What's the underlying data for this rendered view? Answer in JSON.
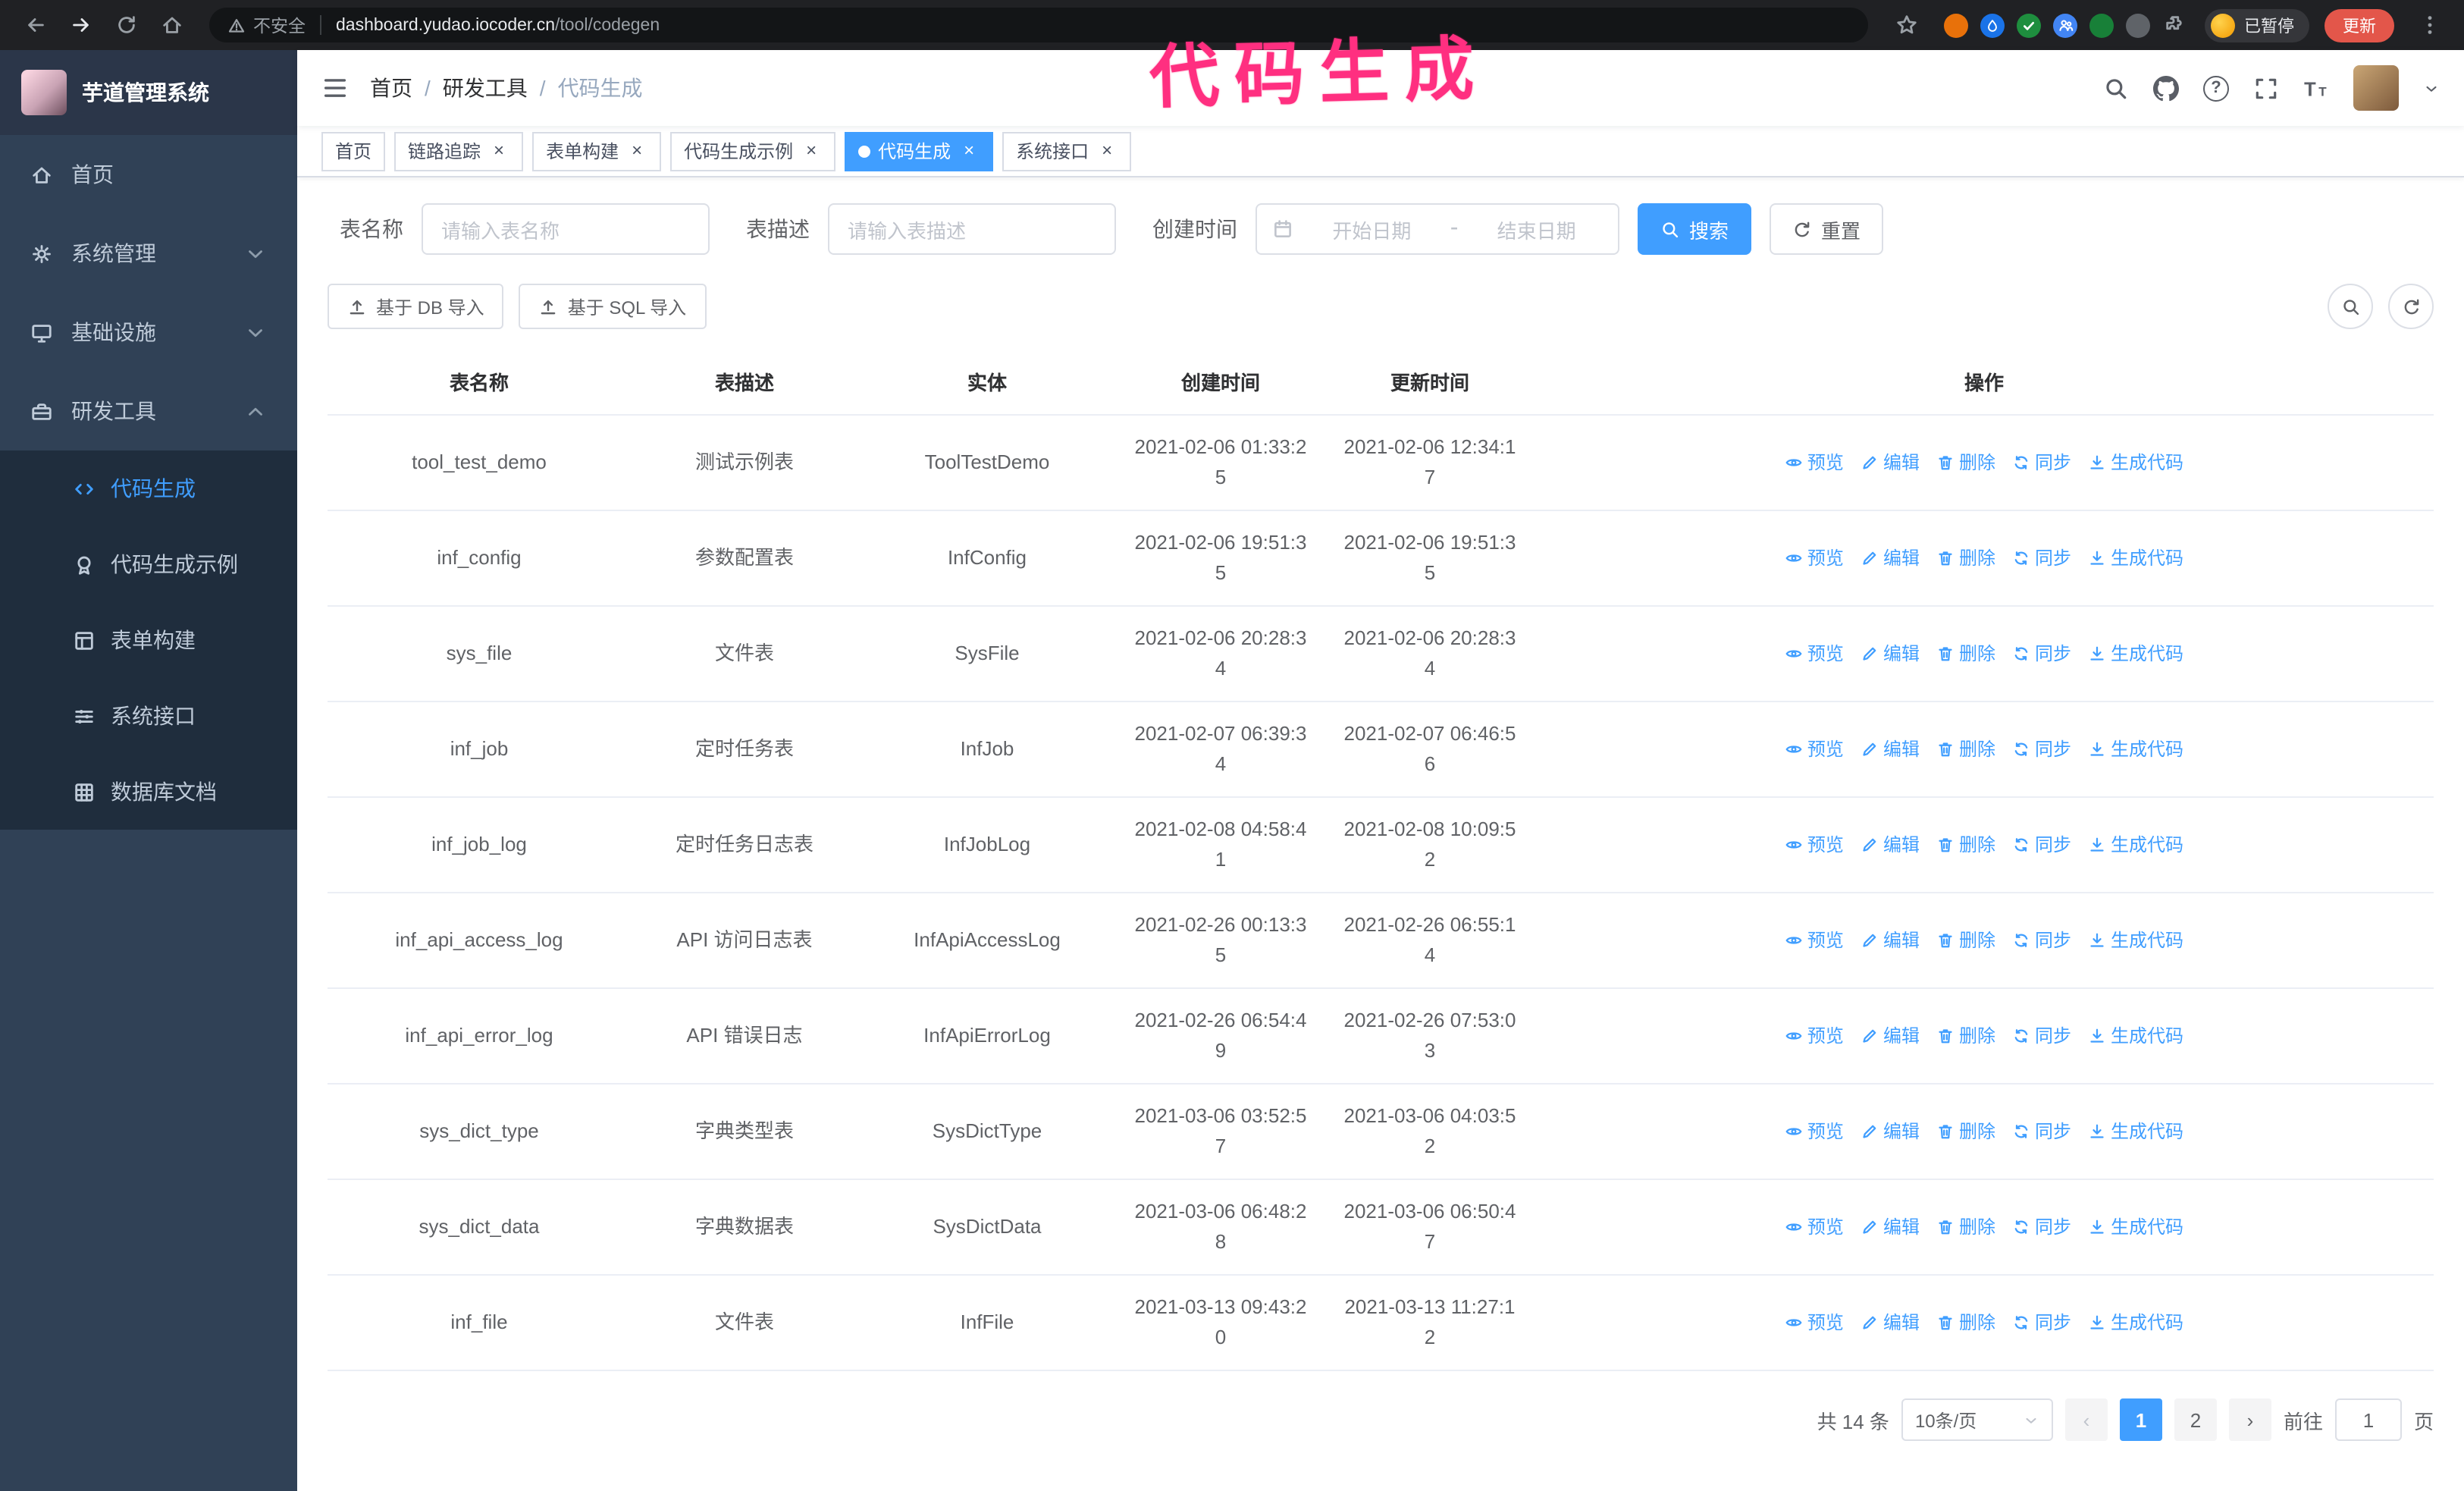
{
  "browser": {
    "not_secure": "不安全",
    "url_host": "dashboard.yudao.iocoder.cn",
    "url_path": "/tool/codegen",
    "paused_badge": "已暂停",
    "update_button": "更新"
  },
  "annotation": {
    "text": "代码生成",
    "color": "#ff2f80"
  },
  "sidebar": {
    "logo_title": "芋道管理系统",
    "items": [
      {
        "key": "home",
        "label": "首页",
        "icon": "home"
      },
      {
        "key": "system-manage",
        "label": "系统管理",
        "icon": "gear",
        "chevron": "down"
      },
      {
        "key": "infrastructure",
        "label": "基础设施",
        "icon": "monitor",
        "chevron": "down"
      },
      {
        "key": "dev-tools",
        "label": "研发工具",
        "icon": "toolbox",
        "chevron": "up",
        "expanded": true,
        "children": [
          {
            "key": "codegen",
            "label": "代码生成",
            "icon": "code",
            "active": true
          },
          {
            "key": "codegen-example",
            "label": "代码生成示例",
            "icon": "badge"
          },
          {
            "key": "form-builder",
            "label": "表单构建",
            "icon": "form"
          },
          {
            "key": "system-api",
            "label": "系统接口",
            "icon": "sliders"
          },
          {
            "key": "db-doc",
            "label": "数据库文档",
            "icon": "grid"
          }
        ]
      }
    ]
  },
  "navbar": {
    "breadcrumb": [
      "首页",
      "研发工具",
      "代码生成"
    ]
  },
  "tags": [
    {
      "key": "home",
      "label": "首页",
      "closable": false,
      "active": false
    },
    {
      "key": "tracer",
      "label": "链路追踪",
      "closable": true,
      "active": false
    },
    {
      "key": "form-builder",
      "label": "表单构建",
      "closable": true,
      "active": false
    },
    {
      "key": "codegen-example",
      "label": "代码生成示例",
      "closable": true,
      "active": false
    },
    {
      "key": "codegen",
      "label": "代码生成",
      "closable": true,
      "active": true
    },
    {
      "key": "system-api",
      "label": "系统接口",
      "closable": true,
      "active": false
    }
  ],
  "filters": {
    "name_label": "表名称",
    "name_placeholder": "请输入表名称",
    "desc_label": "表描述",
    "desc_placeholder": "请输入表描述",
    "time_label": "创建时间",
    "start_placeholder": "开始日期",
    "range_separator": "-",
    "end_placeholder": "结束日期",
    "search_button": "搜索",
    "reset_button": "重置"
  },
  "toolbar": {
    "import_db": "基于 DB 导入",
    "import_sql": "基于 SQL 导入"
  },
  "table": {
    "columns": [
      "表名称",
      "表描述",
      "实体",
      "创建时间",
      "更新时间",
      "操作"
    ],
    "op_labels": [
      {
        "label": "预览",
        "icon": "eye"
      },
      {
        "label": "编辑",
        "icon": "edit"
      },
      {
        "label": "删除",
        "icon": "trash"
      },
      {
        "label": "同步",
        "icon": "sync"
      },
      {
        "label": "生成代码",
        "icon": "download"
      }
    ],
    "rows": [
      {
        "name": "tool_test_demo",
        "desc": "测试示例表",
        "entity": "ToolTestDemo",
        "created": "2021-02-06 01:33:25",
        "updated": "2021-02-06 12:34:17"
      },
      {
        "name": "inf_config",
        "desc": "参数配置表",
        "entity": "InfConfig",
        "created": "2021-02-06 19:51:35",
        "updated": "2021-02-06 19:51:35"
      },
      {
        "name": "sys_file",
        "desc": "文件表",
        "entity": "SysFile",
        "created": "2021-02-06 20:28:34",
        "updated": "2021-02-06 20:28:34"
      },
      {
        "name": "inf_job",
        "desc": "定时任务表",
        "entity": "InfJob",
        "created": "2021-02-07 06:39:34",
        "updated": "2021-02-07 06:46:56"
      },
      {
        "name": "inf_job_log",
        "desc": "定时任务日志表",
        "entity": "InfJobLog",
        "created": "2021-02-08 04:58:41",
        "updated": "2021-02-08 10:09:52"
      },
      {
        "name": "inf_api_access_log",
        "desc": "API 访问日志表",
        "entity": "InfApiAccessLog",
        "created": "2021-02-26 00:13:35",
        "updated": "2021-02-26 06:55:14"
      },
      {
        "name": "inf_api_error_log",
        "desc": "API 错误日志",
        "entity": "InfApiErrorLog",
        "created": "2021-02-26 06:54:49",
        "updated": "2021-02-26 07:53:03"
      },
      {
        "name": "sys_dict_type",
        "desc": "字典类型表",
        "entity": "SysDictType",
        "created": "2021-03-06 03:52:57",
        "updated": "2021-03-06 04:03:52"
      },
      {
        "name": "sys_dict_data",
        "desc": "字典数据表",
        "entity": "SysDictData",
        "created": "2021-03-06 06:48:28",
        "updated": "2021-03-06 06:50:47"
      },
      {
        "name": "inf_file",
        "desc": "文件表",
        "entity": "InfFile",
        "created": "2021-03-13 09:43:20",
        "updated": "2021-03-13 11:27:12"
      }
    ]
  },
  "pagination": {
    "total_text": "共 14 条",
    "page_size": "10条/页",
    "pages": [
      "1",
      "2"
    ],
    "active_page": "1",
    "goto_label": "前往",
    "goto_value": "1",
    "goto_suffix": "页"
  }
}
